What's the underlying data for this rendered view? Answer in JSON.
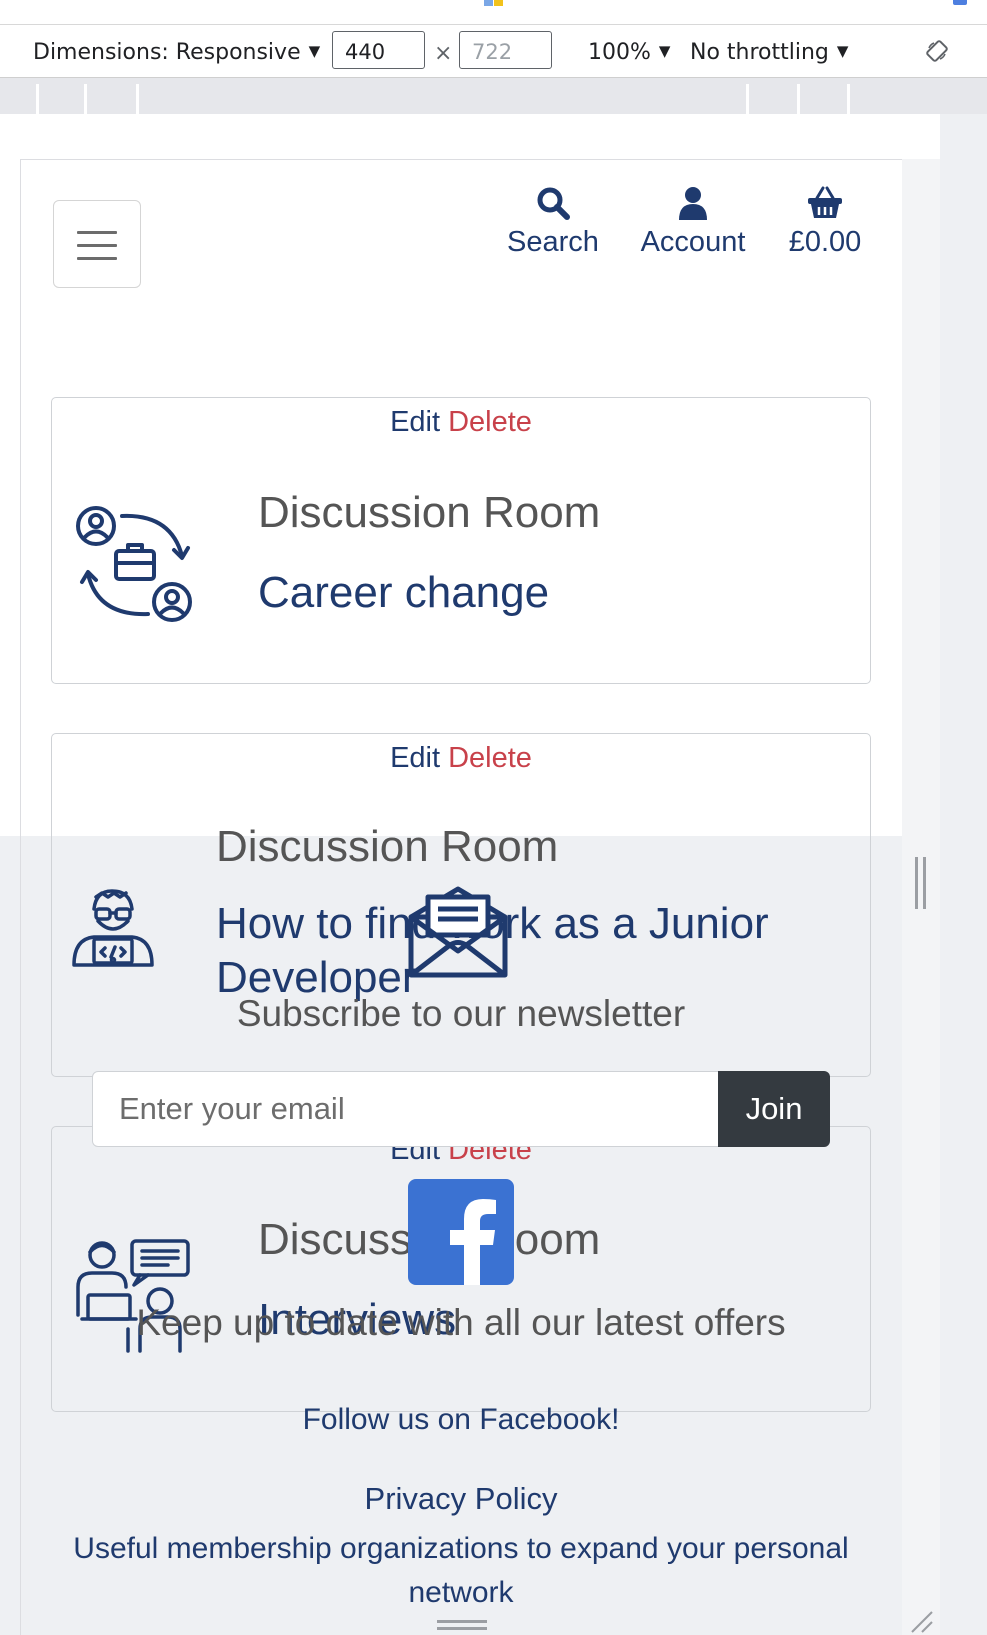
{
  "devtools": {
    "dimensions_label": "Dimensions: Responsive",
    "width_value": "440",
    "height_value": "722",
    "times": "×",
    "zoom": "100%",
    "throttling": "No throttling"
  },
  "header": {
    "search_label": "Search",
    "account_label": "Account",
    "basket_total": "£0.00"
  },
  "cards": [
    {
      "edit": "Edit",
      "delete": "Delete",
      "eyebrow": "Discussion Room",
      "title": "Career change",
      "icon": "career-change-icon"
    },
    {
      "edit": "Edit",
      "delete": "Delete",
      "eyebrow": "Discussion Room",
      "title": "How to find work as a Junior Developer",
      "icon": "junior-developer-icon"
    },
    {
      "edit": "Edit",
      "delete": "Delete",
      "eyebrow": "Discussion Room",
      "title": "Interviews",
      "icon": "interview-icon"
    }
  ],
  "footer": {
    "newsletter_heading": "Subscribe to our newsletter",
    "email_placeholder": "Enter your email",
    "join_label": "Join",
    "keep_up": "Keep up to date with all our latest offers",
    "follow": "Follow us on Facebook!",
    "privacy": "Privacy Policy",
    "useful": "Useful membership organizations to expand your personal network"
  },
  "colors": {
    "brand_navy": "#1f3a6e",
    "delete_red": "#c8414a",
    "facebook_blue": "#3b72d2",
    "join_dark": "#343a40"
  }
}
